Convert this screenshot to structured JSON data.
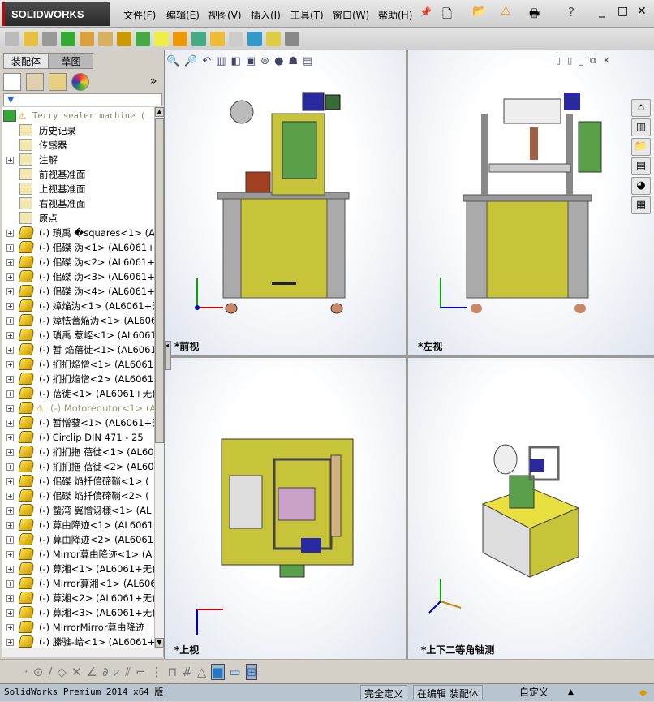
{
  "app": {
    "logo": "SOLIDWORKS",
    "menus": [
      "文件(F)",
      "编辑(E)",
      "视图(V)",
      "插入(I)",
      "工具(T)",
      "窗口(W)",
      "帮助(H)"
    ]
  },
  "panel": {
    "tabs": [
      "装配体",
      "草图"
    ],
    "active_tab": 0,
    "more": "»"
  },
  "tree": {
    "root": "Terry sealer machine  (",
    "items": [
      {
        "label": "历史记录",
        "icon": "history-icon",
        "exp": false
      },
      {
        "label": "传感器",
        "icon": "sensor-icon",
        "exp": false
      },
      {
        "label": "注解",
        "icon": "annotation-icon",
        "exp": true
      },
      {
        "label": "前视基准面",
        "icon": "plane-icon",
        "exp": false
      },
      {
        "label": "上视基准面",
        "icon": "plane-icon",
        "exp": false
      },
      {
        "label": "右视基准面",
        "icon": "plane-icon",
        "exp": false
      },
      {
        "label": "原点",
        "icon": "origin-icon",
        "exp": false
      }
    ],
    "parts": [
      "(-) 瑣禹 �squares<1> (AL6061+ラ",
      "(-) 佀磔 沩<1> (AL6061+ラ",
      "(-) 佀磔 沩<2> (AL6061+ラ",
      "(-) 佀磔 沩<3> (AL6061+ラ",
      "(-) 佀磔 沩<4> (AL6061+ラ",
      "(-) 嫜焔沩<1> (AL6061+无",
      "(-) 嫜怯蓍焔沩<1> (AL606",
      "(-) 瑣禹 惹峌<1> (AL6061",
      "(-) 暂 焔蓓徙<1> (AL6061",
      "(-) 扪扪焔憎<1> (AL6061+",
      "(-) 扪扪焔憎<2> (AL6061+",
      "(-) 蓓徙<1> (AL6061+无色",
      "(-) Motoredutor<1> (A",
      "(-) 暂憎蕟<1> (AL6061+无",
      "(-) Circlip DIN 471 - 25",
      "(-) 扪扪拖 蓓徙<1> (AL60",
      "(-) 扪扪拖 蓓徙<2> (AL60",
      "(-) 佀磔 焔扦僨碲鞝<1> (",
      "(-) 佀磔 焔扦僨碲鞝<2> (",
      "(-) 蟄湾 翼憎讶樣<1> (AL",
      "(-) 萛由降迹<1> (AL6061+",
      "(-) 萛由降迹<2> (AL6061+",
      "(-) Mirror萛由降迹<1> (A",
      "(-) 萛湘<1> (AL6061+无色",
      "(-) Mirror萛湘<1> (AL606",
      "(-) 萛湘<2> (AL6061+无色",
      "(-) 萛湘<3> (AL6061+无色",
      "(-) MirrorMirror萛由降迹",
      "(-) 榺骓-峆<1> (AL6061+ラ"
    ],
    "warning_item": 12
  },
  "views": [
    {
      "label": "*前视"
    },
    {
      "label": "*左视"
    },
    {
      "label": "*上视"
    },
    {
      "label": "*上下二等角轴测"
    }
  ],
  "status": {
    "product": "SolidWorks Premium 2014 x64 版",
    "state": "完全定义",
    "mode": "在编辑 装配体",
    "units": "自定义"
  },
  "colors": {
    "body": "#c8c43a",
    "panel": "#5aa04a",
    "frame": "#9a9a9a",
    "motor": "#2a2aa0"
  }
}
